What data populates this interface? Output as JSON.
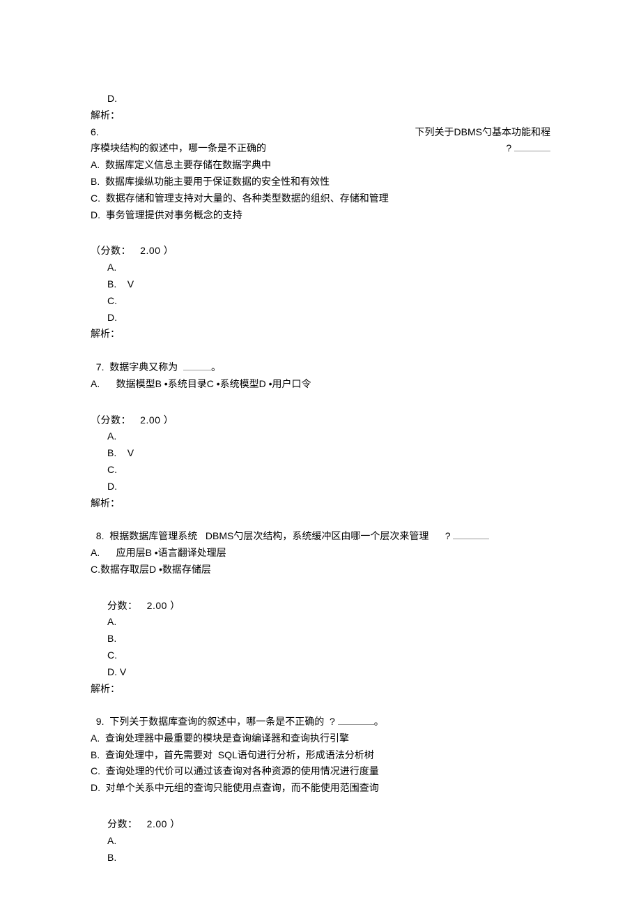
{
  "q5_tail": {
    "optD": "D.",
    "explain": "解析："
  },
  "q6": {
    "num": "6.",
    "right1": "下列关于DBMS勺基本功能和程",
    "line2_left": "序模块结构的叙述中，哪一条是不正确的",
    "line2_right": "?",
    "optA": "A.  数据库定义信息主要存储在数据字典中",
    "optB": "B.  数据库操纵功能主要用于保证数据的安全性和有效性",
    "optC": "C.  数据存储和管理支持对大量的、各种类型数据的组织、存储和管理",
    "optD": "D.  事务管理提供对事务概念的支持",
    "score": "（分数：   2.00 ）",
    "ansA": "A.",
    "ansB": "B.    V",
    "ansC": "C.",
    "ansD": "D.",
    "explain": "解析："
  },
  "q7": {
    "stem_pre": "7.  数据字典又称为  ",
    "stem_post": "。",
    "optA": "A.      数据模型B •系统目录C •系统模型D •用户口令",
    "score": "（分数：   2.00 ）",
    "ansA": "A.",
    "ansB": "B.    V",
    "ansC": "C.",
    "ansD": "D.",
    "explain": "解析："
  },
  "q8": {
    "stem_pre": "8.  根据数据库管理系统   DBMS勺层次结构，系统缓冲区由哪一个层次来管理      ?",
    "optA": "A.      应用层B •语言翻译处理层",
    "optC": "C.数据存取层D •数据存储层",
    "score": "分数：   2.00 ）",
    "ansA": "A.",
    "ansB": "B.",
    "ansC": "C.",
    "ansD": "D. V",
    "explain": "解析："
  },
  "q9": {
    "stem_pre": "9.  下列关于数据库查询的叙述中，哪一条是不正确的  ? ",
    "stem_post": "。",
    "optA": "A.  查询处理器中最重要的模块是查询编译器和查询执行引擎",
    "optB": "B.  查询处理中，首先需要对  SQL语句进行分析，形成语法分析树",
    "optC": "C.  查询处理的代价可以通过该查询对各种资源的使用情况进行度量",
    "optD": "D.  对单个关系中元组的查询只能使用点查询，而不能使用范围查询",
    "score": "分数：   2.00 ）",
    "ansA": "A.",
    "ansB": "B."
  }
}
